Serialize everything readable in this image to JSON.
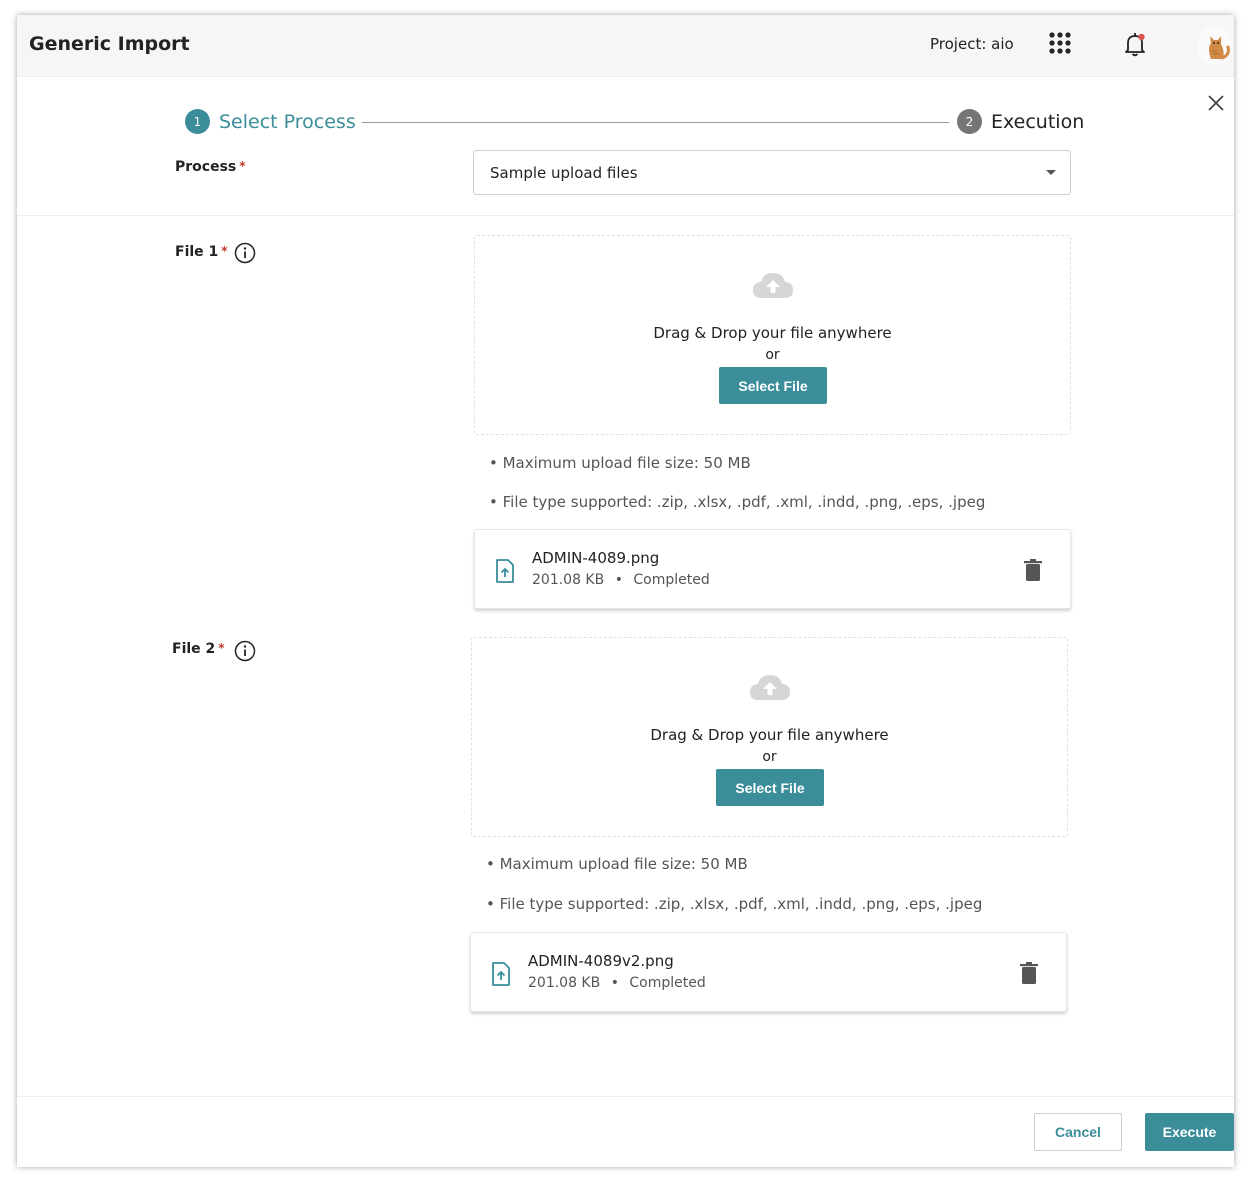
{
  "header": {
    "title": "Generic Import",
    "project": "Project: aio",
    "icons": [
      "apps-grid-icon",
      "bell-icon",
      "avatar-cat"
    ],
    "notification_dot_color": "#d9534f"
  },
  "stepper": {
    "steps": [
      {
        "number": "1",
        "label": "Select Process",
        "state": "active"
      },
      {
        "number": "2",
        "label": "Execution",
        "state": "inactive"
      }
    ]
  },
  "process": {
    "label": "Process",
    "required_mark": "*",
    "selected": "Sample upload files"
  },
  "files": [
    {
      "label": "File 1",
      "required_mark": "*",
      "dropzone_text": "Drag & Drop your file anywhere",
      "or_text": "or",
      "select_button": "Select File",
      "max_size_hint": "• Maximum upload file size: 50 MB",
      "types_hint": "• File type supported: .zip, .xlsx, .pdf, .xml, .indd, .png, .eps, .jpeg",
      "uploaded": {
        "name": "ADMIN-4089.png",
        "size": "201.08 KB",
        "separator": "•",
        "status": "Completed"
      }
    },
    {
      "label": "File 2",
      "required_mark": "*",
      "dropzone_text": "Drag & Drop your file anywhere",
      "or_text": "or",
      "select_button": "Select File",
      "max_size_hint": "• Maximum upload file size: 50 MB",
      "types_hint": "• File type supported: .zip, .xlsx, .pdf, .xml, .indd, .png, .eps, .jpeg",
      "uploaded": {
        "name": "ADMIN-4089v2.png",
        "size": "201.08 KB",
        "separator": "•",
        "status": "Completed"
      }
    }
  ],
  "footer": {
    "cancel": "Cancel",
    "execute": "Execute"
  },
  "colors": {
    "accent": "#3a8d99",
    "required": "#c0392b"
  }
}
